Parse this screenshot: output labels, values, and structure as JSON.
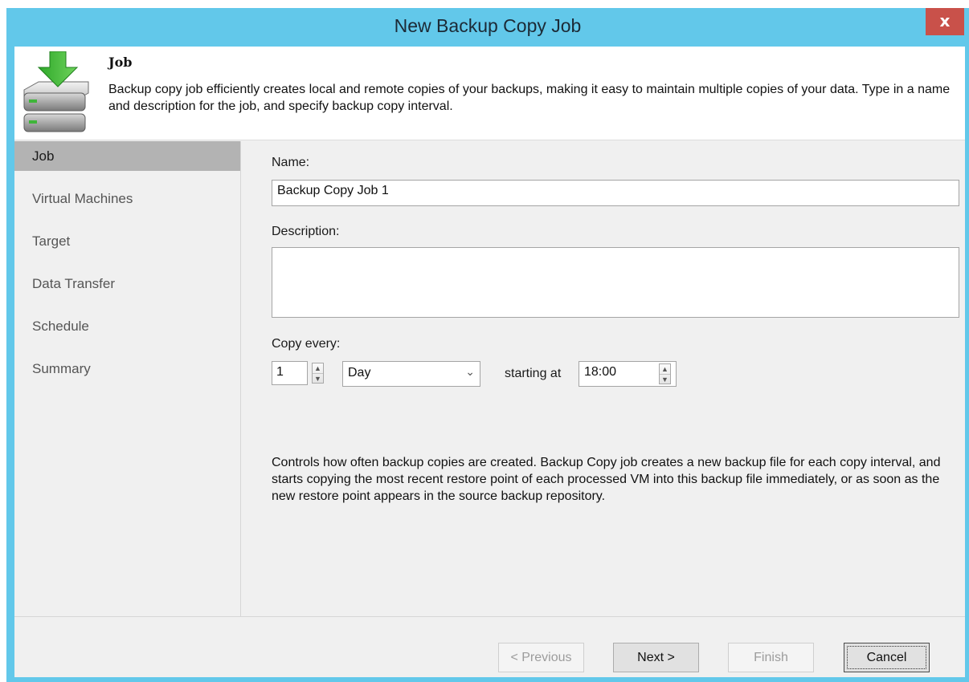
{
  "window": {
    "title": "New Backup Copy Job",
    "close_label": "x"
  },
  "header": {
    "title": "Job",
    "description": "Backup copy job efficiently creates local and remote copies of your backups, making it easy to maintain multiple copies of your data. Type in a name and description for the job, and specify backup copy interval."
  },
  "sidebar": {
    "items": [
      {
        "label": "Job",
        "active": true
      },
      {
        "label": "Virtual Machines",
        "active": false
      },
      {
        "label": "Target",
        "active": false
      },
      {
        "label": "Data Transfer",
        "active": false
      },
      {
        "label": "Schedule",
        "active": false
      },
      {
        "label": "Summary",
        "active": false
      }
    ]
  },
  "form": {
    "name_label": "Name:",
    "name_value": "Backup Copy Job 1",
    "description_label": "Description:",
    "description_value": "",
    "copy_every_label": "Copy every:",
    "interval_value": "1",
    "interval_unit": "Day",
    "starting_at_label": "starting at",
    "start_time": "18:00",
    "info_text": "Controls how often backup copies are created. Backup Copy job creates a new backup file for each copy interval, and starts copying the most recent restore point of each processed VM into this backup file immediately, or as soon as the new restore point appears in the source backup repository."
  },
  "footer": {
    "previous_label": "< Previous",
    "next_label": "Next >",
    "finish_label": "Finish",
    "cancel_label": "Cancel"
  },
  "colors": {
    "titlebar": "#62c8ea",
    "close": "#c9514a",
    "active_nav": "#b3b3b3"
  },
  "icons": {
    "wizard": "backup-storage-download-icon",
    "spin_up": "chevron-up-icon",
    "spin_down": "chevron-down-icon",
    "combo": "chevron-down-icon"
  }
}
